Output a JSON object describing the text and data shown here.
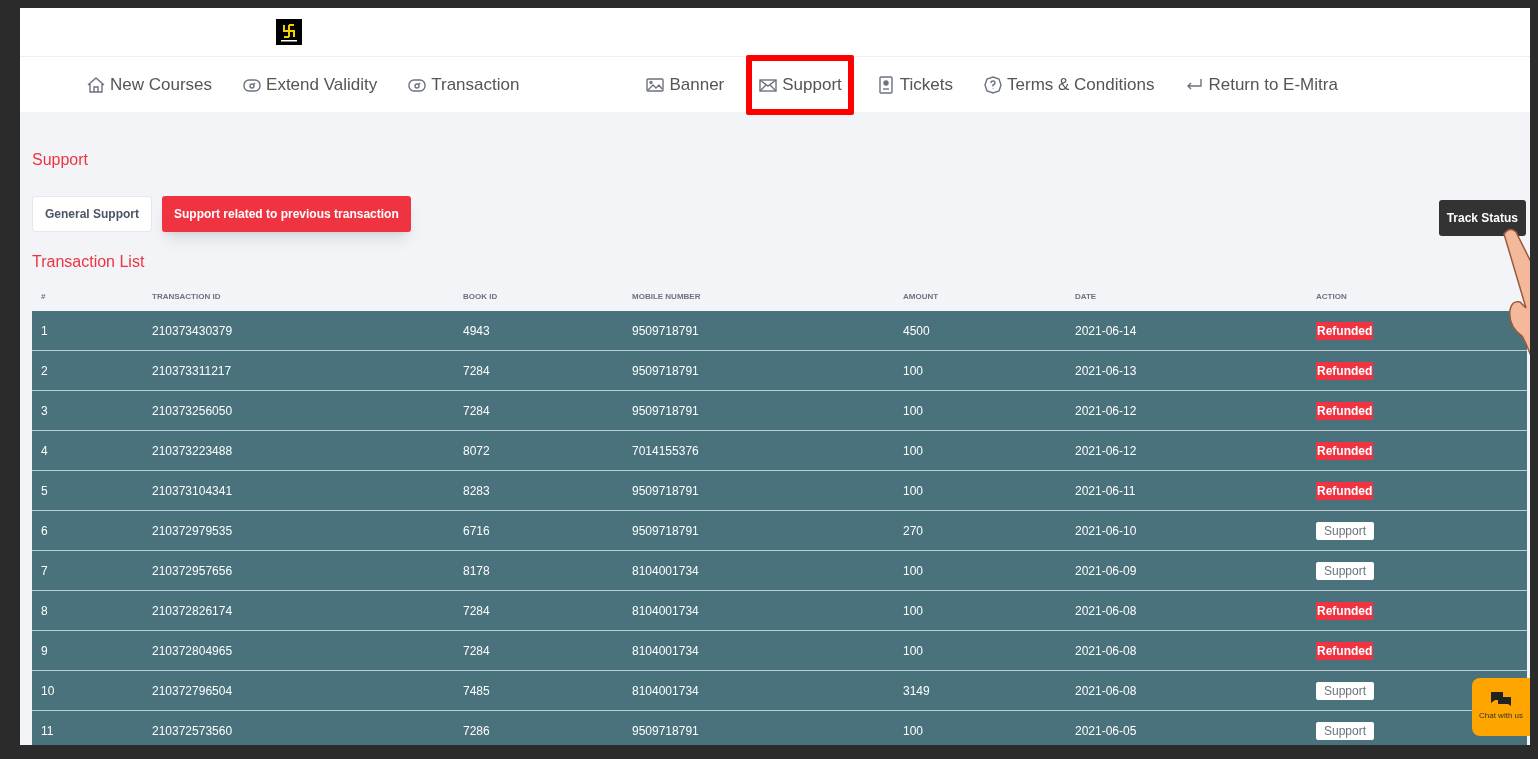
{
  "nav": [
    {
      "label": "New Courses",
      "highlighted": false
    },
    {
      "label": "Extend Validity",
      "highlighted": false
    },
    {
      "label": "Transaction",
      "highlighted": false
    },
    {
      "label": "Banner",
      "highlighted": false
    },
    {
      "label": "Support",
      "highlighted": true
    },
    {
      "label": "Tickets",
      "highlighted": false
    },
    {
      "label": "Terms & Conditions",
      "highlighted": false
    },
    {
      "label": "Return to E-Mitra",
      "highlighted": false
    }
  ],
  "page_title": "Support",
  "support_tabs": [
    {
      "label": "General Support",
      "selected": false
    },
    {
      "label": "Support related to previous transaction",
      "selected": true
    }
  ],
  "track_button": "Track Status",
  "list_title": "Transaction List",
  "table": {
    "columns": [
      "#",
      "TRANSACTION ID",
      "BOOK ID",
      "MOBILE NUMBER",
      "AMOUNT",
      "DATE",
      "ACTION"
    ],
    "rows": [
      {
        "cells": [
          "1",
          "210373430379",
          "4943",
          "9509718791",
          "4500",
          "2021-06-14"
        ],
        "action": {
          "kind": "refunded",
          "label": "Refunded"
        }
      },
      {
        "cells": [
          "2",
          "210373311217",
          "7284",
          "9509718791",
          "100",
          "2021-06-13"
        ],
        "action": {
          "kind": "refunded",
          "label": "Refunded"
        }
      },
      {
        "cells": [
          "3",
          "210373256050",
          "7284",
          "9509718791",
          "100",
          "2021-06-12"
        ],
        "action": {
          "kind": "refunded",
          "label": "Refunded"
        }
      },
      {
        "cells": [
          "4",
          "210373223488",
          "8072",
          "7014155376",
          "100",
          "2021-06-12"
        ],
        "action": {
          "kind": "refunded",
          "label": "Refunded"
        }
      },
      {
        "cells": [
          "5",
          "210373104341",
          "8283",
          "9509718791",
          "100",
          "2021-06-11"
        ],
        "action": {
          "kind": "refunded",
          "label": "Refunded"
        }
      },
      {
        "cells": [
          "6",
          "210372979535",
          "6716",
          "9509718791",
          "270",
          "2021-06-10"
        ],
        "action": {
          "kind": "support",
          "label": "Support"
        }
      },
      {
        "cells": [
          "7",
          "210372957656",
          "8178",
          "8104001734",
          "100",
          "2021-06-09"
        ],
        "action": {
          "kind": "support",
          "label": "Support"
        }
      },
      {
        "cells": [
          "8",
          "210372826174",
          "7284",
          "8104001734",
          "100",
          "2021-06-08"
        ],
        "action": {
          "kind": "refunded",
          "label": "Refunded"
        }
      },
      {
        "cells": [
          "9",
          "210372804965",
          "7284",
          "8104001734",
          "100",
          "2021-06-08"
        ],
        "action": {
          "kind": "refunded",
          "label": "Refunded"
        }
      },
      {
        "cells": [
          "10",
          "210372796504",
          "7485",
          "8104001734",
          "3149",
          "2021-06-08"
        ],
        "action": {
          "kind": "support",
          "label": "Support"
        }
      },
      {
        "cells": [
          "11",
          "210372573560",
          "7286",
          "9509718791",
          "100",
          "2021-06-05"
        ],
        "action": {
          "kind": "support",
          "label": "Support"
        }
      }
    ]
  },
  "chat_widget": {
    "label": "Chat with us"
  }
}
